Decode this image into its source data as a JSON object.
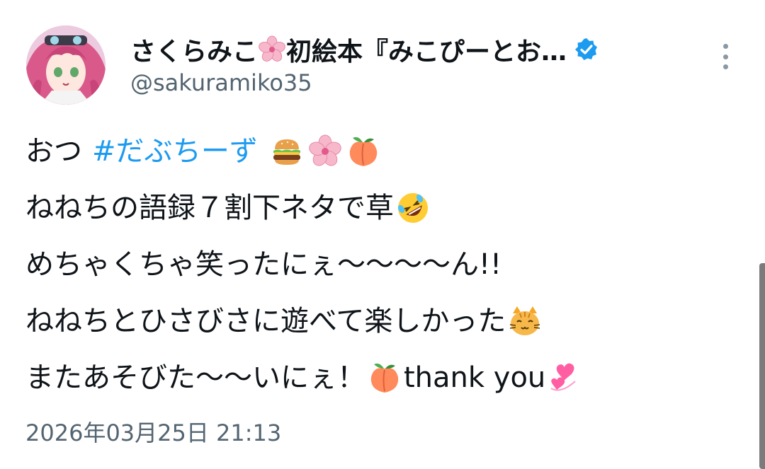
{
  "author": {
    "display_name_part1": "さくらみこ",
    "display_name_part2": "初絵本『みこぴーとお…",
    "name_emoji": "cherry-blossom-icon",
    "verified": true,
    "handle": "@sakuramiko35",
    "avatar": "avatar-pink-hair-character"
  },
  "tweet": {
    "lines": [
      {
        "text1": "おつ",
        "hashtag": "#だぶちーず",
        "emojis": [
          "hamburger-icon",
          "cherry-blossom-icon",
          "peach-icon"
        ]
      },
      {
        "text1": "ねねちの語録７割下ネタで草",
        "emojis": [
          "rolling-laughing-face-icon"
        ]
      },
      {
        "text1": "めちゃくちゃ笑ったにぇ〜〜〜〜ん!!"
      },
      {
        "text1": "ねねちとひさびさに遊べて楽しかった",
        "emojis": [
          "cat-face-icon"
        ]
      },
      {
        "text1": "またあそびた〜〜いにぇ！",
        "emoji_mid": "peach-icon",
        "text2": "thank you",
        "emojis": [
          "revolving-hearts-icon"
        ]
      }
    ]
  },
  "timestamp": "2026年03月25日 21:13",
  "colors": {
    "text": "#0f1419",
    "secondary": "#536471",
    "link": "#1d9bf0",
    "verified": "#1d9bf0"
  }
}
